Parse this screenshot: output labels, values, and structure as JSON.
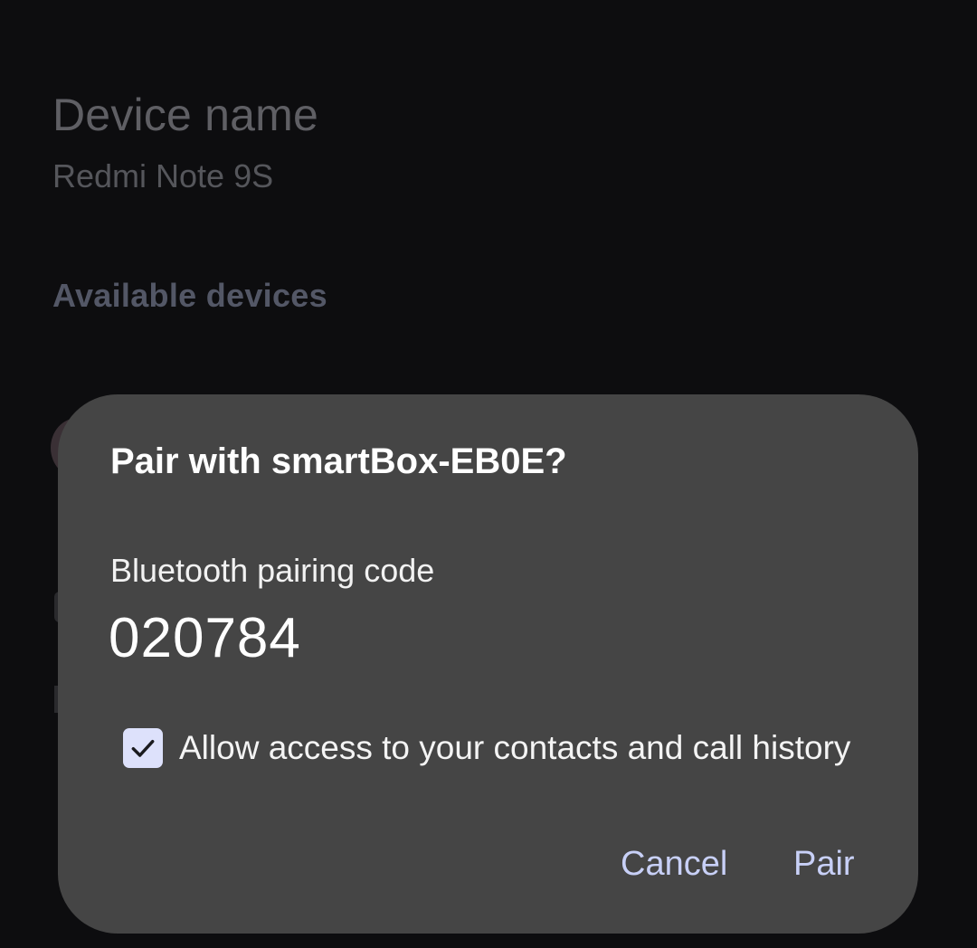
{
  "background": {
    "device_name_title": "Device name",
    "device_name_value": "Redmi Note 9S",
    "available_devices_header": "Available devices"
  },
  "dialog": {
    "title": "Pair with smartBox-EB0E?",
    "code_label": "Bluetooth pairing code",
    "code_value": "020784",
    "checkbox_label": "Allow access to your contacts and call history",
    "checkbox_checked": true,
    "cancel_label": "Cancel",
    "pair_label": "Pair"
  },
  "colors": {
    "background": "#0d0d0f",
    "dialog_surface": "#454545",
    "accent": "#c8d0f7",
    "checkbox_fill": "#dde1fb"
  },
  "icons": {
    "checkbox": "check-icon"
  }
}
